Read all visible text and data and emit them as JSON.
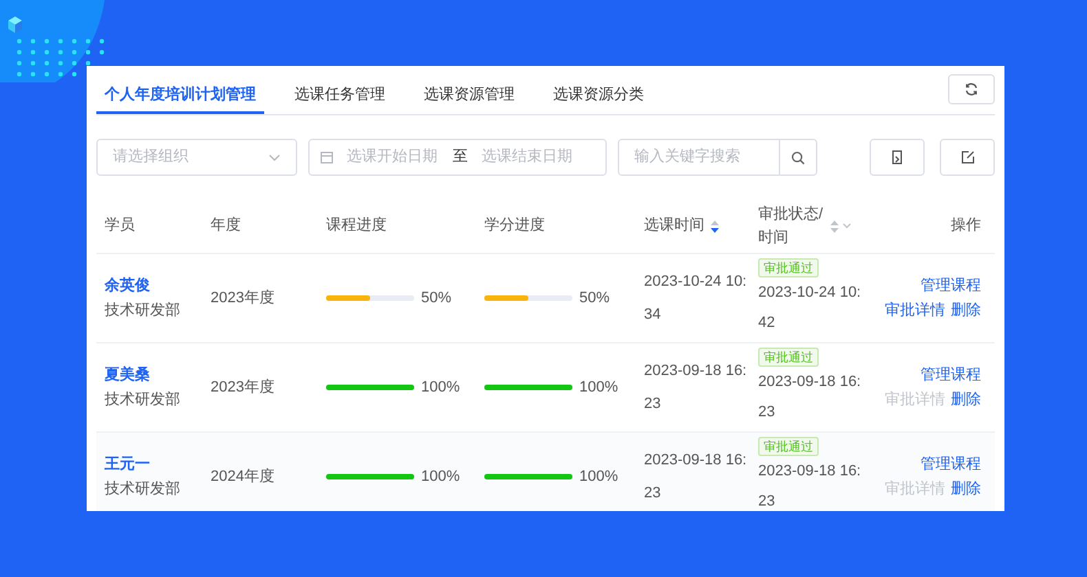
{
  "tabs": [
    {
      "label": "个人年度培训计划管理",
      "selected": true
    },
    {
      "label": "选课任务管理",
      "selected": false
    },
    {
      "label": "选课资源管理",
      "selected": false
    },
    {
      "label": "选课资源分类",
      "selected": false
    }
  ],
  "filters": {
    "org": {
      "placeholder": "请选择组织"
    },
    "start_date": {
      "placeholder": "选课开始日期"
    },
    "separator": "至",
    "end_date": {
      "placeholder": "选课结束日期"
    },
    "search": {
      "placeholder": "输入关键字搜索"
    }
  },
  "table": {
    "columns": [
      {
        "label": "学员"
      },
      {
        "label": "年度"
      },
      {
        "label": "课程进度"
      },
      {
        "label": "学分进度"
      },
      {
        "label": "选课时间",
        "sortable": true,
        "sort_desc": true
      },
      {
        "label": "审批状态/时间",
        "sortable": true,
        "sort_desc": false,
        "filterable": true
      },
      {
        "label": "操作"
      }
    ],
    "rows": [
      {
        "name": "余英俊",
        "dept": "技术研发部",
        "year": "2023年度",
        "course": {
          "level": 0.5,
          "text": "50%"
        },
        "credit": {
          "level": 0.5,
          "text": "50%"
        },
        "select_time": "2023-10-24 10:34",
        "status": "审批通过",
        "approve_time": "2023-10-24 10:42",
        "actions": {
          "manage": "管理课程",
          "detail": "审批详情",
          "detail_disabled": false,
          "delete": "删除"
        }
      },
      {
        "name": "夏美桑",
        "dept": "技术研发部",
        "year": "2023年度",
        "course": {
          "level": 1,
          "text": "100%"
        },
        "credit": {
          "level": 1,
          "text": "100%"
        },
        "select_time": "2023-09-18 16:23",
        "status": "审批通过",
        "approve_time": "2023-09-18 16:23",
        "actions": {
          "manage": "管理课程",
          "detail": "审批详情",
          "detail_disabled": true,
          "delete": "删除"
        }
      },
      {
        "name": "王元一",
        "dept": "技术研发部",
        "year": "2024年度",
        "course": {
          "level": 1,
          "text": "100%"
        },
        "credit": {
          "level": 1,
          "text": "100%"
        },
        "select_time": "2023-09-18 16:23",
        "status": "审批通过",
        "approve_time": "2023-09-18 16:23",
        "actions": {
          "manage": "管理课程",
          "detail": "审批详情",
          "detail_disabled": true,
          "delete": "删除"
        }
      }
    ]
  }
}
